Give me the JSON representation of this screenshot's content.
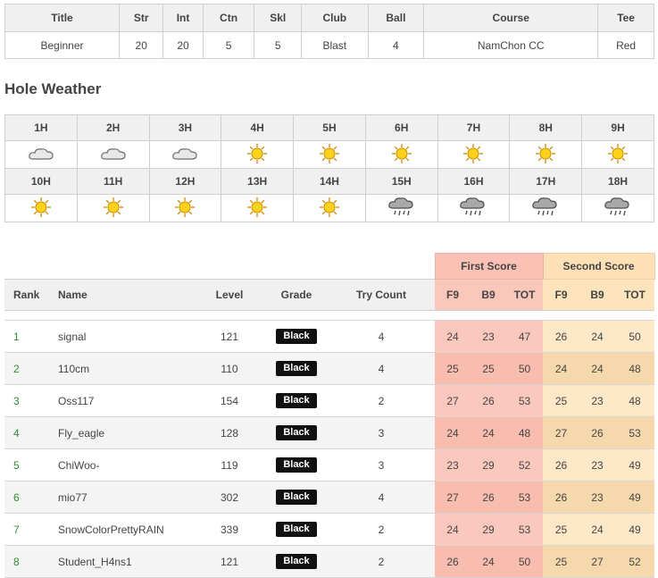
{
  "course_info": {
    "headers": [
      "Title",
      "Str",
      "Int",
      "Ctn",
      "Skl",
      "Club",
      "Ball",
      "Course",
      "Tee"
    ],
    "values": [
      "Beginner",
      "20",
      "20",
      "5",
      "5",
      "Blast",
      "4",
      "NamChon CC",
      "Red"
    ]
  },
  "weather_section": {
    "title": "Hole Weather",
    "front": [
      {
        "hole": "1H",
        "weather": "cloud-icon"
      },
      {
        "hole": "2H",
        "weather": "cloud-icon"
      },
      {
        "hole": "3H",
        "weather": "cloud-icon"
      },
      {
        "hole": "4H",
        "weather": "sun-icon"
      },
      {
        "hole": "5H",
        "weather": "sun-icon"
      },
      {
        "hole": "6H",
        "weather": "sun-icon"
      },
      {
        "hole": "7H",
        "weather": "sun-icon"
      },
      {
        "hole": "8H",
        "weather": "sun-icon"
      },
      {
        "hole": "9H",
        "weather": "sun-icon"
      }
    ],
    "back": [
      {
        "hole": "10H",
        "weather": "sun-icon"
      },
      {
        "hole": "11H",
        "weather": "sun-icon"
      },
      {
        "hole": "12H",
        "weather": "sun-icon"
      },
      {
        "hole": "13H",
        "weather": "sun-icon"
      },
      {
        "hole": "14H",
        "weather": "sun-icon"
      },
      {
        "hole": "15H",
        "weather": "rain-icon"
      },
      {
        "hole": "16H",
        "weather": "rain-icon"
      },
      {
        "hole": "17H",
        "weather": "rain-icon"
      },
      {
        "hole": "18H",
        "weather": "rain-icon"
      }
    ]
  },
  "ranking": {
    "group_headers": {
      "first": "First Score",
      "second": "Second Score"
    },
    "columns": {
      "rank": "Rank",
      "name": "Name",
      "level": "Level",
      "grade": "Grade",
      "try_count": "Try Count",
      "f9": "F9",
      "b9": "B9",
      "tot": "TOT"
    },
    "rows": [
      {
        "rank": "1",
        "name": "signal",
        "level": "121",
        "grade": "Black",
        "try": "4",
        "first": [
          "24",
          "23",
          "47"
        ],
        "second": [
          "26",
          "24",
          "50"
        ]
      },
      {
        "rank": "2",
        "name": "110cm",
        "level": "110",
        "grade": "Black",
        "try": "4",
        "first": [
          "25",
          "25",
          "50"
        ],
        "second": [
          "24",
          "24",
          "48"
        ]
      },
      {
        "rank": "3",
        "name": "Oss117",
        "level": "154",
        "grade": "Black",
        "try": "2",
        "first": [
          "27",
          "26",
          "53"
        ],
        "second": [
          "25",
          "23",
          "48"
        ]
      },
      {
        "rank": "4",
        "name": "Fly_eagle",
        "level": "128",
        "grade": "Black",
        "try": "3",
        "first": [
          "24",
          "24",
          "48"
        ],
        "second": [
          "27",
          "26",
          "53"
        ]
      },
      {
        "rank": "5",
        "name": "ChiWoo-",
        "level": "119",
        "grade": "Black",
        "try": "3",
        "first": [
          "23",
          "29",
          "52"
        ],
        "second": [
          "26",
          "23",
          "49"
        ]
      },
      {
        "rank": "6",
        "name": "mio77",
        "level": "302",
        "grade": "Black",
        "try": "4",
        "first": [
          "27",
          "26",
          "53"
        ],
        "second": [
          "26",
          "23",
          "49"
        ]
      },
      {
        "rank": "7",
        "name": "SnowColorPrettyRAIN",
        "level": "339",
        "grade": "Black",
        "try": "2",
        "first": [
          "24",
          "29",
          "53"
        ],
        "second": [
          "25",
          "24",
          "49"
        ]
      },
      {
        "rank": "8",
        "name": "Student_H4ns1",
        "level": "121",
        "grade": "Black",
        "try": "2",
        "first": [
          "26",
          "24",
          "50"
        ],
        "second": [
          "25",
          "27",
          "52"
        ]
      }
    ]
  },
  "colors": {
    "rank_green": "#2f8f2f",
    "first_bg": "#fbc1b5",
    "second_bg": "#fde0b5",
    "grade_bg": "#111111"
  }
}
